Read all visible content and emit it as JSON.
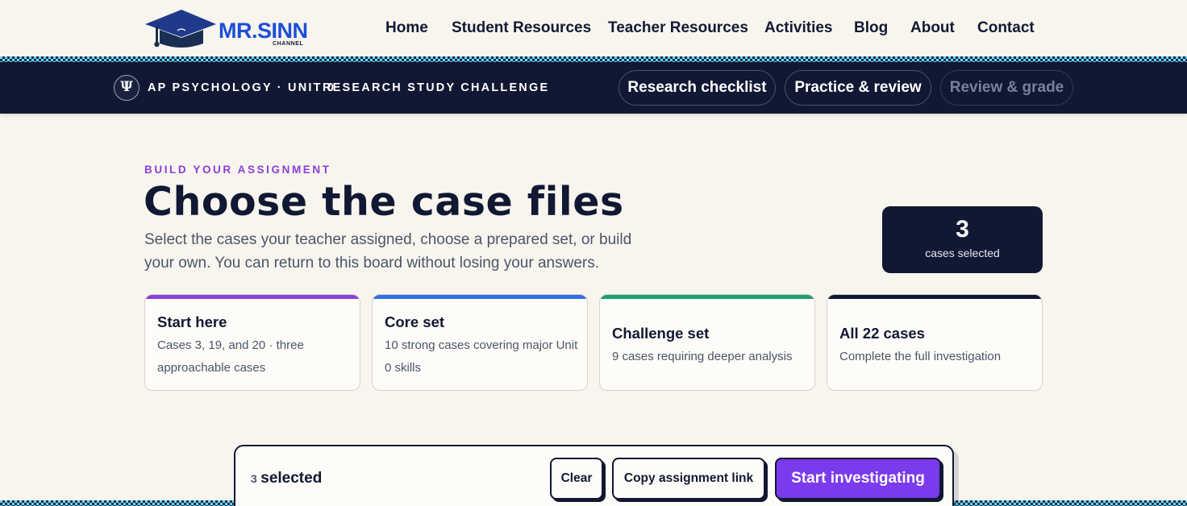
{
  "brand": {
    "name": "MR.SINN",
    "sub": "CHANNEL"
  },
  "nav": {
    "items": [
      {
        "label": "Home"
      },
      {
        "label": "Student Resources"
      },
      {
        "label": "Teacher Resources"
      },
      {
        "label": "Activities"
      },
      {
        "label": "Blog"
      },
      {
        "label": "About"
      },
      {
        "label": "Contact"
      }
    ]
  },
  "subnav": {
    "icon_glyph": "Ψ",
    "course": "AP PSYCHOLOGY · UNIT 0",
    "challenge": "RESEARCH STUDY CHALLENGE",
    "tabs": [
      {
        "label": "Research checklist"
      },
      {
        "label": "Practice & review"
      },
      {
        "label": "Review & grade"
      }
    ]
  },
  "hero": {
    "eyebrow": "BUILD YOUR ASSIGNMENT",
    "title": "Choose the case files",
    "lead": "Select the cases your teacher assigned, choose a prepared set, or build your own. You can return to this board without losing your answers."
  },
  "counter": {
    "value": "3",
    "label": "cases selected"
  },
  "sets": [
    {
      "title": "Start here",
      "desc": "Cases 3, 19, and 20 · three approachable cases",
      "color": "#8b3fd9"
    },
    {
      "title": "Core set",
      "desc": "10 strong cases covering major Unit 0 skills",
      "color": "#2f6fe0"
    },
    {
      "title": "Challenge set",
      "desc": "9 cases requiring deeper analysis",
      "color": "#1e9e6e"
    },
    {
      "title": "All 22 cases",
      "desc": "Complete the full investigation",
      "color": "#111833"
    }
  ],
  "actionbar": {
    "count": "3",
    "selected_label": "selected",
    "clear": "Clear",
    "copy_link": "Copy assignment link",
    "start": "Start investigating"
  },
  "colors": {
    "navy": "#111833",
    "accent_purple": "#7c3aed",
    "brand_blue": "#1d4ed8",
    "page_bg": "#f8f5ee"
  }
}
